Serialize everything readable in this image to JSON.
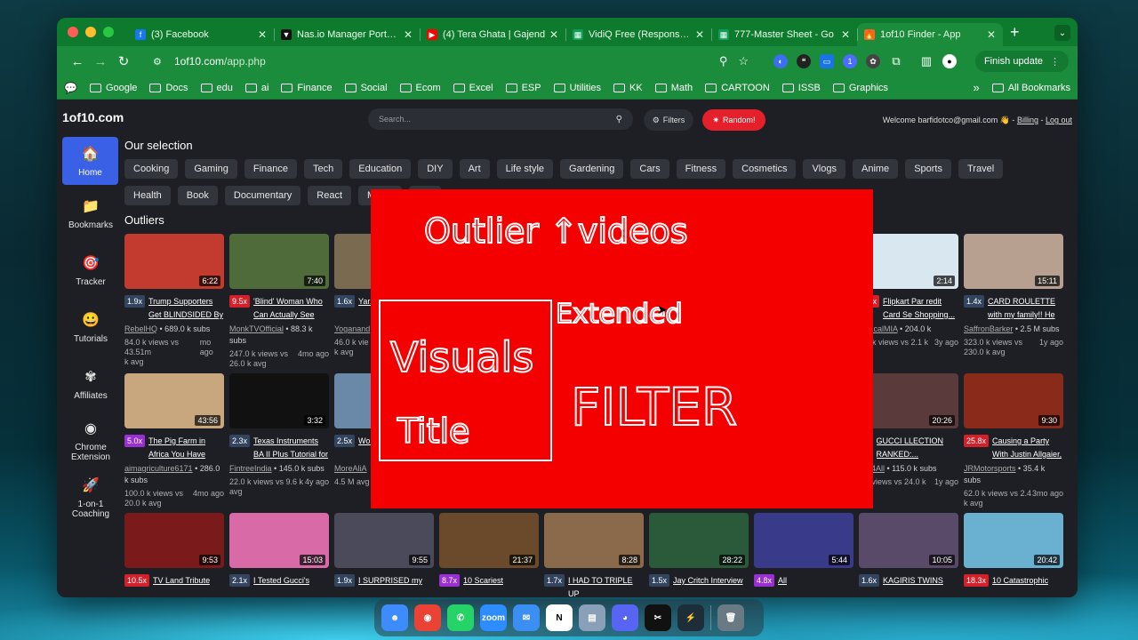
{
  "browser": {
    "tabs": [
      {
        "title": "(3) Facebook",
        "color": "#1877f2",
        "glyph": "f"
      },
      {
        "title": "Nas.io Manager Portal -",
        "color": "#111111",
        "glyph": "▼"
      },
      {
        "title": "(4) Tera Ghata | Gajend",
        "color": "#ff0000",
        "glyph": "▶"
      },
      {
        "title": "VidiQ Free (Responses)",
        "color": "#0f9d58",
        "glyph": "▦"
      },
      {
        "title": "777-Master Sheet - Go",
        "color": "#0f9d58",
        "glyph": "▦"
      },
      {
        "title": "1of10 Finder - App",
        "color": "#f36a1e",
        "glyph": "🔥",
        "active": true
      }
    ],
    "url_host": "1of10.com",
    "url_path": "/app.php",
    "finish_update_label": "Finish update",
    "bookmarks": [
      "Google",
      "Docs",
      "edu",
      "ai",
      "Finance",
      "Social",
      "Ecom",
      "Excel",
      "ESP",
      "Utilities",
      "KK",
      "Math",
      "CARTOON",
      "ISSB",
      "Graphics"
    ],
    "all_bookmarks_label": "All Bookmarks"
  },
  "app": {
    "logo": "1of10.com",
    "search_placeholder": "Search...",
    "filters_label": "Filters",
    "random_label": "Random!",
    "welcome_text": "Welcome barfidotco@gmail.com 👋 -",
    "billing_label": "Billing",
    "logout_label": "Log out",
    "sidebar": [
      {
        "label": "Home",
        "icon": "🏠",
        "active": true
      },
      {
        "label": "Bookmarks",
        "icon": "📁"
      },
      {
        "label": "Tracker",
        "icon": "🎯"
      },
      {
        "label": "Tutorials",
        "icon": "😀"
      },
      {
        "label": "Affiliates",
        "icon": "✾"
      },
      {
        "label": "Chrome Extension",
        "icon": "◉"
      },
      {
        "label": "1-on-1 Coaching",
        "icon": "🚀"
      }
    ],
    "selection_title": "Our selection",
    "categories": [
      "Cooking",
      "Gaming",
      "Finance",
      "Tech",
      "Education",
      "DIY",
      "Art",
      "Life style",
      "Gardening",
      "Cars",
      "Fitness",
      "Cosmetics",
      "Vlogs",
      "Anime",
      "Sports",
      "Travel",
      "Health",
      "Book",
      "Documentary",
      "React",
      "Music",
      "Ani"
    ],
    "outliers_title": "Outliers",
    "videos": [
      {
        "dur": "6:22",
        "mult": "1.9x",
        "badge": "blue",
        "title": "Trump Supporters Get BLINDSIDED By Wha...",
        "channel": "RebelHQ",
        "subs": "• 689.0 k subs",
        "views": "84.0 k views vs 43.51m",
        "avg": "k avg",
        "age": "mo ago",
        "thumb": "#c23b2e"
      },
      {
        "dur": "7:40",
        "mult": "9.5x",
        "badge": "red",
        "title": "'Blind' Woman Who Can Actually See Turns...",
        "channel": "MonkTVOfficial",
        "subs": "• 88.3 k subs",
        "views": "247.0 k views vs",
        "avg": "26.0 k avg",
        "age": "4mo ago",
        "thumb": "#4f6b3a"
      },
      {
        "dur": "",
        "mult": "1.6x",
        "badge": "blue",
        "title": "Yar... \"How-to-l...",
        "channel": "Yoganand",
        "subs": "",
        "views": "46.0 k vie",
        "avg": "k avg",
        "age": "",
        "thumb": "#7a6a50"
      },
      {
        "dur": "",
        "mult": "",
        "badge": "",
        "title": "",
        "channel": "",
        "subs": "",
        "views": "",
        "avg": "",
        "age": "",
        "thumb": "#333"
      },
      {
        "dur": "",
        "mult": "",
        "badge": "",
        "title": "",
        "channel": "",
        "subs": "",
        "views": "",
        "avg": "",
        "age": "",
        "thumb": "#333"
      },
      {
        "dur": "",
        "mult": "",
        "badge": "",
        "title": "",
        "channel": "",
        "subs": "",
        "views": "",
        "avg": "",
        "age": "",
        "thumb": "#333"
      },
      {
        "dur": "",
        "mult": "",
        "badge": "",
        "title": "",
        "channel": "",
        "subs": "",
        "views": "",
        "avg": "",
        "age": "",
        "thumb": "#333"
      },
      {
        "dur": "2:14",
        "mult": "5.6x",
        "badge": "red",
        "title": "Flipkart Par redit Card Se Shopping...",
        "channel": "chnicalMIA",
        "subs": "• 204.0 k",
        "views": "7.0 k views vs 2.1 k",
        "avg": "avg",
        "age": "3y ago",
        "thumb": "#d9e8f0"
      },
      {
        "dur": "15:11",
        "mult": "1.4x",
        "badge": "blue",
        "title": "CARD ROULETTE with my family!! He paid...",
        "channel": "SaffronBarker",
        "subs": "• 2.5 M subs",
        "views": "323.0 k views vs",
        "avg": "230.0 k avg",
        "age": "1y ago",
        "thumb": "#b8a090"
      },
      {
        "dur": "43:56",
        "mult": "5.0x",
        "badge": "purple",
        "title": "The Pig Farm in Africa You Have Never...",
        "channel": "aimagriculture6171",
        "subs": "• 286.0 k subs",
        "views": "100.0 k views vs",
        "avg": "20.0 k avg",
        "age": "4mo ago",
        "thumb": "#c9a77e"
      },
      {
        "dur": "3:32",
        "mult": "2.3x",
        "badge": "blue",
        "title": "Texas Instruments BA II Plus Tutorial for CFA...",
        "channel": "FintreeIndia",
        "subs": "• 145.0 k subs",
        "views": "22.0 k views vs 9.6 k",
        "avg": "avg",
        "age": "4y ago",
        "thumb": "#111"
      },
      {
        "dur": "",
        "mult": "2.5x",
        "badge": "blue",
        "title": "Wo... TRY NOT...",
        "channel": "MoreAliA",
        "subs": "",
        "views": "4.5 M avg",
        "avg": "",
        "age": "",
        "thumb": "#6a88a8"
      },
      {
        "dur": "",
        "mult": "",
        "badge": "",
        "title": "",
        "channel": "",
        "subs": "",
        "views": "",
        "avg": "",
        "age": "",
        "thumb": "#333"
      },
      {
        "dur": "",
        "mult": "",
        "badge": "",
        "title": "",
        "channel": "",
        "subs": "",
        "views": "",
        "avg": "",
        "age": "",
        "thumb": "#333"
      },
      {
        "dur": "",
        "mult": "",
        "badge": "",
        "title": "",
        "channel": "",
        "subs": "",
        "views": "",
        "avg": "",
        "age": "",
        "thumb": "#333"
      },
      {
        "dur": "",
        "mult": "",
        "badge": "",
        "title": "",
        "channel": "",
        "subs": "",
        "views": "",
        "avg": "",
        "age": "",
        "thumb": "#333"
      },
      {
        "dur": "20:26",
        "mult": "5x",
        "badge": "blue",
        "title": "GUCCI LLECTION RANKED:...",
        "channel": "oks4All",
        "subs": "• 115.0 k subs",
        "views": "0 k views vs 24.0 k",
        "avg": "avg",
        "age": "1y ago",
        "thumb": "#5a3a3a"
      },
      {
        "dur": "9:30",
        "mult": "25.8x",
        "badge": "red",
        "title": "Causing a Party With Justin Allgaier, Kelle...",
        "channel": "JRMotorsports",
        "subs": "• 35.4 k subs",
        "views": "62.0 k views vs 2.4",
        "avg": "k avg",
        "age": "3mo ago",
        "thumb": "#8a2a1a"
      },
      {
        "dur": "9:53",
        "mult": "10.5x",
        "badge": "red",
        "title": "TV Land Tribute",
        "channel": "",
        "subs": "",
        "views": "",
        "avg": "",
        "age": "",
        "thumb": "#7a1a1a"
      },
      {
        "dur": "15:03",
        "mult": "2.1x",
        "badge": "blue",
        "title": "I Tested Gucci's",
        "channel": "",
        "subs": "",
        "views": "",
        "avg": "",
        "age": "",
        "thumb": "#d86aa8"
      },
      {
        "dur": "9:55",
        "mult": "1.9x",
        "badge": "blue",
        "title": "I SURPRISED my",
        "channel": "",
        "subs": "",
        "views": "",
        "avg": "",
        "age": "",
        "thumb": "#4a4a5a"
      },
      {
        "dur": "21:37",
        "mult": "8.7x",
        "badge": "purple",
        "title": "10 Scariest",
        "channel": "",
        "subs": "",
        "views": "",
        "avg": "",
        "age": "",
        "thumb": "#6a4a2a"
      },
      {
        "dur": "8:28",
        "mult": "1.7x",
        "badge": "blue",
        "title": "I HAD TO TRIPLE UP",
        "channel": "",
        "subs": "",
        "views": "",
        "avg": "",
        "age": "",
        "thumb": "#8a6a4a"
      },
      {
        "dur": "28:22",
        "mult": "1.5x",
        "badge": "blue",
        "title": "Jay Critch Interview",
        "channel": "",
        "subs": "",
        "views": "",
        "avg": "",
        "age": "",
        "thumb": "#2a5a3a"
      },
      {
        "dur": "5:44",
        "mult": "4.8x",
        "badge": "purple",
        "title": "All",
        "channel": "",
        "subs": "",
        "views": "",
        "avg": "",
        "age": "",
        "thumb": "#3a3a8a"
      },
      {
        "dur": "10:05",
        "mult": "1.6x",
        "badge": "blue",
        "title": "KAGIRIS TWINS",
        "channel": "",
        "subs": "",
        "views": "",
        "avg": "",
        "age": "",
        "thumb": "#5a4a6a"
      },
      {
        "dur": "20:42",
        "mult": "18.3x",
        "badge": "red",
        "title": "10 Catastrophic",
        "channel": "",
        "subs": "",
        "views": "",
        "avg": "",
        "age": "",
        "thumb": "#6ab0d0"
      }
    ]
  },
  "overlay": {
    "background": "#f40000",
    "line1": "Outlier ↑videos",
    "line2": "Extended",
    "line3": "Visuals",
    "line4": "Title",
    "line5": "FILTER"
  },
  "dock": [
    {
      "name": "finder",
      "color": "#3d8bfd",
      "glyph": "☻"
    },
    {
      "name": "chrome",
      "color": "#ea4335",
      "glyph": "◉"
    },
    {
      "name": "whatsapp",
      "color": "#25d366",
      "glyph": "✆"
    },
    {
      "name": "zoom",
      "color": "#2d8cff",
      "glyph": "zoom"
    },
    {
      "name": "mail",
      "color": "#3b8ff3",
      "glyph": "✉"
    },
    {
      "name": "notion",
      "color": "#ffffff",
      "glyph": "N"
    },
    {
      "name": "preview",
      "color": "#8aa0b8",
      "glyph": "▤"
    },
    {
      "name": "discord",
      "color": "#5865f2",
      "glyph": "◕"
    },
    {
      "name": "capcut",
      "color": "#111111",
      "glyph": "✂"
    },
    {
      "name": "app",
      "color": "#1e2d3a",
      "glyph": "⚡"
    },
    {
      "name": "trash",
      "color": "#6a7a85",
      "glyph": "🗑"
    }
  ]
}
